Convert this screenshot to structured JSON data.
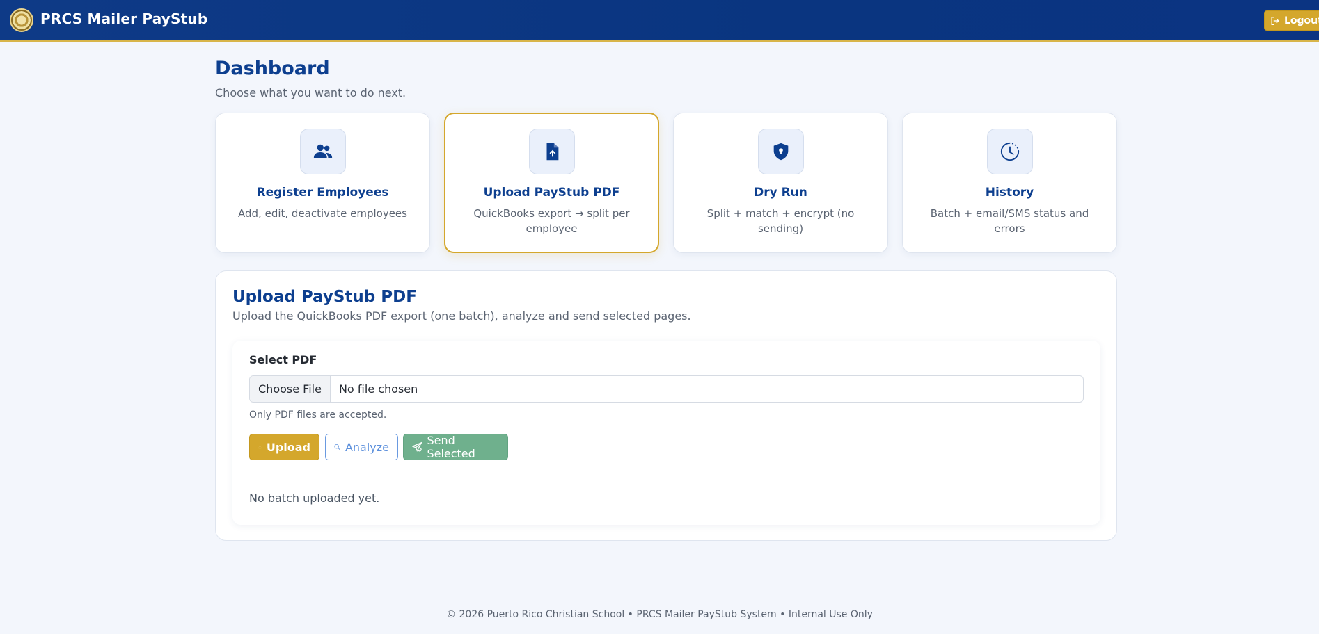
{
  "header": {
    "brand_title": "PRCS Mailer PayStub",
    "logout_label": "Logout"
  },
  "page": {
    "title": "Dashboard",
    "subtitle": "Choose what you want to do next."
  },
  "cards": [
    {
      "title": "Register Employees",
      "desc": "Add, edit, deactivate employees",
      "icon": "users-icon"
    },
    {
      "title": "Upload PayStub PDF",
      "desc": "QuickBooks export → split per employee",
      "icon": "file-upload-icon",
      "active": true
    },
    {
      "title": "Dry Run",
      "desc": "Split + match + encrypt (no sending)",
      "icon": "shield-lock-icon"
    },
    {
      "title": "History",
      "desc": "Batch + email/SMS status and errors",
      "icon": "clock-history-icon"
    }
  ],
  "upload_panel": {
    "title": "Upload PayStub PDF",
    "subtitle": "Upload the QuickBooks PDF export (one batch), analyze and send selected pages.",
    "select_label": "Select PDF",
    "choose_file_label": "Choose File",
    "file_status": "No file chosen",
    "help_text": "Only PDF files are accepted.",
    "upload_label": "Upload",
    "analyze_label": "Analyze",
    "send_label": "Send Selected",
    "empty_text": "No batch uploaded yet."
  },
  "footer": {
    "text": "© 2026 Puerto Rico Christian School • PRCS Mailer PayStub System • Internal Use Only"
  },
  "colors": {
    "primary": "#0d3f8f",
    "accent": "#d4a72c",
    "send": "#6fb08d",
    "analyze": "#5b8fdc"
  }
}
